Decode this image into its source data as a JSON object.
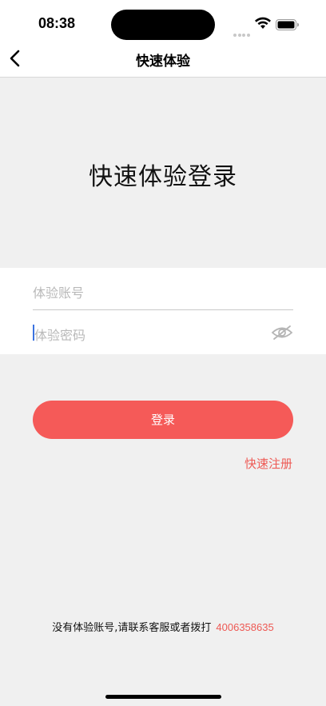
{
  "status_bar": {
    "time": "08:38",
    "icons": [
      "signal-icon",
      "wifi-icon",
      "battery-icon"
    ]
  },
  "nav": {
    "title": "快速体验",
    "back_icon": "chevron-left-icon"
  },
  "heading": "快速体验登录",
  "form": {
    "account_placeholder": "体验账号",
    "password_placeholder": "体验密码",
    "eye_icon": "eye-hidden-icon"
  },
  "login_button": "登录",
  "register_link": "快速注册",
  "footer": {
    "text": "没有体验账号,请联系客服或者拨打",
    "phone": "4006358635"
  },
  "colors": {
    "accent": "#f55a58",
    "link": "#ee5a55",
    "background": "#f0f0f0",
    "panel": "#ffffff"
  }
}
